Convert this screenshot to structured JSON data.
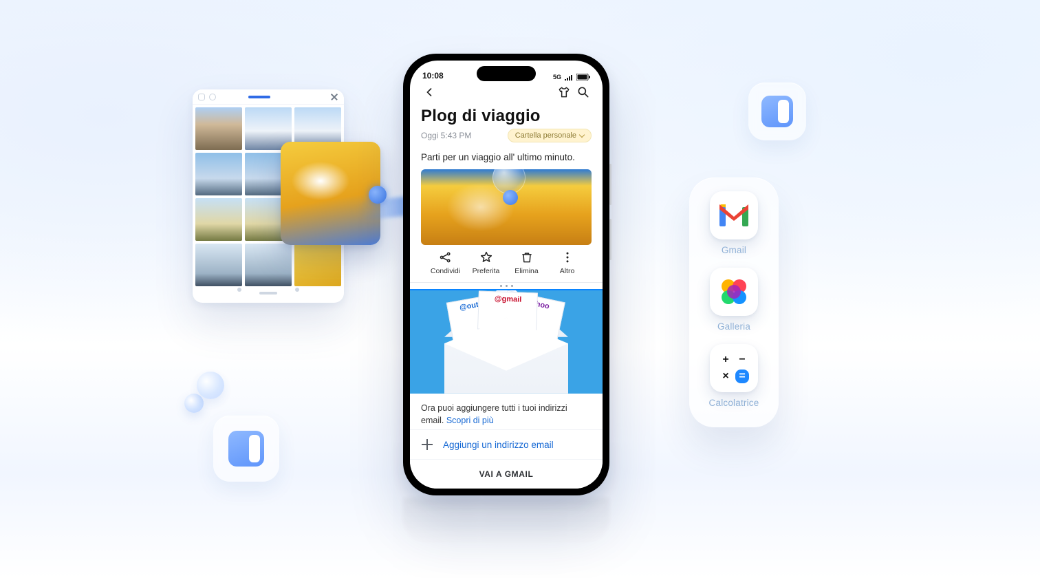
{
  "statusbar": {
    "time": "10:08",
    "net": "5G"
  },
  "note": {
    "title": "Plog di viaggio",
    "timestamp": "Oggi 5:43 PM",
    "folder_chip": "Cartella personale",
    "body": "Parti per un viaggio all' ultimo minuto."
  },
  "actions": {
    "share": "Condividi",
    "favorite": "Preferita",
    "delete": "Elimina",
    "more": "Altro"
  },
  "envelope_tags": {
    "outlook": "@outlook",
    "gmail": "@gmail",
    "yahoo": "@yahoo"
  },
  "promo": {
    "text": "Ora puoi aggiungere tutti i tuoi indirizzi email. ",
    "link": "Scopri di più"
  },
  "add_email": "Aggiungi un indirizzo email",
  "footer_cta": "VAI A GMAIL",
  "dock": {
    "gmail": "Gmail",
    "gallery": "Galleria",
    "calculator": "Calcolatrice"
  },
  "calc_keys": {
    "plus": "+",
    "minus": "−",
    "times": "×",
    "equals": "="
  }
}
